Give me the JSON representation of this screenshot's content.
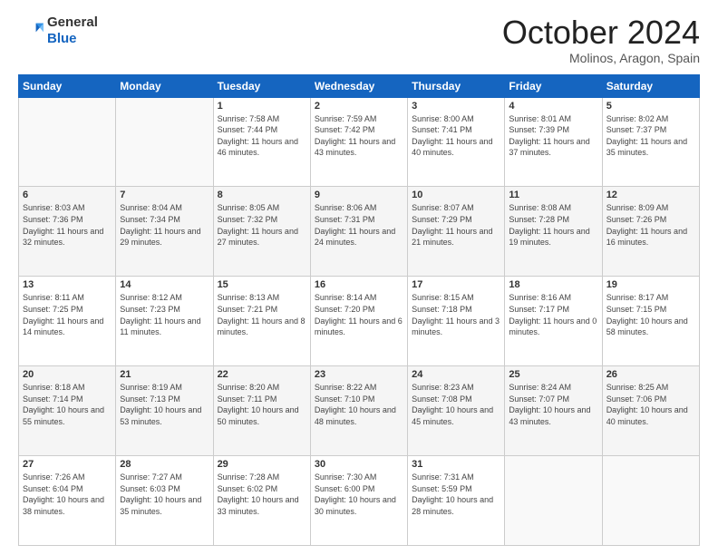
{
  "logo": {
    "general": "General",
    "blue": "Blue"
  },
  "title": "October 2024",
  "location": "Molinos, Aragon, Spain",
  "days_of_week": [
    "Sunday",
    "Monday",
    "Tuesday",
    "Wednesday",
    "Thursday",
    "Friday",
    "Saturday"
  ],
  "weeks": [
    [
      {
        "day": null
      },
      {
        "day": null
      },
      {
        "day": "1",
        "sunrise": "Sunrise: 7:58 AM",
        "sunset": "Sunset: 7:44 PM",
        "daylight": "Daylight: 11 hours and 46 minutes."
      },
      {
        "day": "2",
        "sunrise": "Sunrise: 7:59 AM",
        "sunset": "Sunset: 7:42 PM",
        "daylight": "Daylight: 11 hours and 43 minutes."
      },
      {
        "day": "3",
        "sunrise": "Sunrise: 8:00 AM",
        "sunset": "Sunset: 7:41 PM",
        "daylight": "Daylight: 11 hours and 40 minutes."
      },
      {
        "day": "4",
        "sunrise": "Sunrise: 8:01 AM",
        "sunset": "Sunset: 7:39 PM",
        "daylight": "Daylight: 11 hours and 37 minutes."
      },
      {
        "day": "5",
        "sunrise": "Sunrise: 8:02 AM",
        "sunset": "Sunset: 7:37 PM",
        "daylight": "Daylight: 11 hours and 35 minutes."
      }
    ],
    [
      {
        "day": "6",
        "sunrise": "Sunrise: 8:03 AM",
        "sunset": "Sunset: 7:36 PM",
        "daylight": "Daylight: 11 hours and 32 minutes."
      },
      {
        "day": "7",
        "sunrise": "Sunrise: 8:04 AM",
        "sunset": "Sunset: 7:34 PM",
        "daylight": "Daylight: 11 hours and 29 minutes."
      },
      {
        "day": "8",
        "sunrise": "Sunrise: 8:05 AM",
        "sunset": "Sunset: 7:32 PM",
        "daylight": "Daylight: 11 hours and 27 minutes."
      },
      {
        "day": "9",
        "sunrise": "Sunrise: 8:06 AM",
        "sunset": "Sunset: 7:31 PM",
        "daylight": "Daylight: 11 hours and 24 minutes."
      },
      {
        "day": "10",
        "sunrise": "Sunrise: 8:07 AM",
        "sunset": "Sunset: 7:29 PM",
        "daylight": "Daylight: 11 hours and 21 minutes."
      },
      {
        "day": "11",
        "sunrise": "Sunrise: 8:08 AM",
        "sunset": "Sunset: 7:28 PM",
        "daylight": "Daylight: 11 hours and 19 minutes."
      },
      {
        "day": "12",
        "sunrise": "Sunrise: 8:09 AM",
        "sunset": "Sunset: 7:26 PM",
        "daylight": "Daylight: 11 hours and 16 minutes."
      }
    ],
    [
      {
        "day": "13",
        "sunrise": "Sunrise: 8:11 AM",
        "sunset": "Sunset: 7:25 PM",
        "daylight": "Daylight: 11 hours and 14 minutes."
      },
      {
        "day": "14",
        "sunrise": "Sunrise: 8:12 AM",
        "sunset": "Sunset: 7:23 PM",
        "daylight": "Daylight: 11 hours and 11 minutes."
      },
      {
        "day": "15",
        "sunrise": "Sunrise: 8:13 AM",
        "sunset": "Sunset: 7:21 PM",
        "daylight": "Daylight: 11 hours and 8 minutes."
      },
      {
        "day": "16",
        "sunrise": "Sunrise: 8:14 AM",
        "sunset": "Sunset: 7:20 PM",
        "daylight": "Daylight: 11 hours and 6 minutes."
      },
      {
        "day": "17",
        "sunrise": "Sunrise: 8:15 AM",
        "sunset": "Sunset: 7:18 PM",
        "daylight": "Daylight: 11 hours and 3 minutes."
      },
      {
        "day": "18",
        "sunrise": "Sunrise: 8:16 AM",
        "sunset": "Sunset: 7:17 PM",
        "daylight": "Daylight: 11 hours and 0 minutes."
      },
      {
        "day": "19",
        "sunrise": "Sunrise: 8:17 AM",
        "sunset": "Sunset: 7:15 PM",
        "daylight": "Daylight: 10 hours and 58 minutes."
      }
    ],
    [
      {
        "day": "20",
        "sunrise": "Sunrise: 8:18 AM",
        "sunset": "Sunset: 7:14 PM",
        "daylight": "Daylight: 10 hours and 55 minutes."
      },
      {
        "day": "21",
        "sunrise": "Sunrise: 8:19 AM",
        "sunset": "Sunset: 7:13 PM",
        "daylight": "Daylight: 10 hours and 53 minutes."
      },
      {
        "day": "22",
        "sunrise": "Sunrise: 8:20 AM",
        "sunset": "Sunset: 7:11 PM",
        "daylight": "Daylight: 10 hours and 50 minutes."
      },
      {
        "day": "23",
        "sunrise": "Sunrise: 8:22 AM",
        "sunset": "Sunset: 7:10 PM",
        "daylight": "Daylight: 10 hours and 48 minutes."
      },
      {
        "day": "24",
        "sunrise": "Sunrise: 8:23 AM",
        "sunset": "Sunset: 7:08 PM",
        "daylight": "Daylight: 10 hours and 45 minutes."
      },
      {
        "day": "25",
        "sunrise": "Sunrise: 8:24 AM",
        "sunset": "Sunset: 7:07 PM",
        "daylight": "Daylight: 10 hours and 43 minutes."
      },
      {
        "day": "26",
        "sunrise": "Sunrise: 8:25 AM",
        "sunset": "Sunset: 7:06 PM",
        "daylight": "Daylight: 10 hours and 40 minutes."
      }
    ],
    [
      {
        "day": "27",
        "sunrise": "Sunrise: 7:26 AM",
        "sunset": "Sunset: 6:04 PM",
        "daylight": "Daylight: 10 hours and 38 minutes."
      },
      {
        "day": "28",
        "sunrise": "Sunrise: 7:27 AM",
        "sunset": "Sunset: 6:03 PM",
        "daylight": "Daylight: 10 hours and 35 minutes."
      },
      {
        "day": "29",
        "sunrise": "Sunrise: 7:28 AM",
        "sunset": "Sunset: 6:02 PM",
        "daylight": "Daylight: 10 hours and 33 minutes."
      },
      {
        "day": "30",
        "sunrise": "Sunrise: 7:30 AM",
        "sunset": "Sunset: 6:00 PM",
        "daylight": "Daylight: 10 hours and 30 minutes."
      },
      {
        "day": "31",
        "sunrise": "Sunrise: 7:31 AM",
        "sunset": "Sunset: 5:59 PM",
        "daylight": "Daylight: 10 hours and 28 minutes."
      },
      {
        "day": null
      },
      {
        "day": null
      }
    ]
  ]
}
